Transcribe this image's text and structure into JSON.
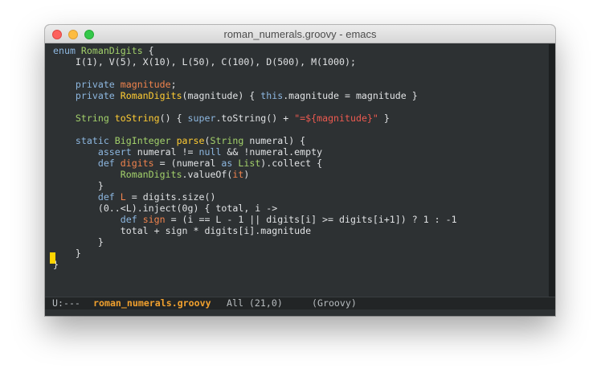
{
  "window": {
    "title": "roman_numerals.groovy - emacs"
  },
  "editor": {
    "lines": [
      [
        {
          "t": "enum ",
          "c": "kw"
        },
        {
          "t": "RomanDigits",
          "c": "ty"
        },
        {
          "t": " {",
          "c": ""
        }
      ],
      [
        {
          "t": "    I(1), V(5), X(10), L(50), C(100), D(500), M(1000);",
          "c": ""
        }
      ],
      [],
      [
        {
          "t": "    ",
          "c": ""
        },
        {
          "t": "private ",
          "c": "kw"
        },
        {
          "t": "magnitude",
          "c": "vr"
        },
        {
          "t": ";",
          "c": ""
        }
      ],
      [
        {
          "t": "    ",
          "c": ""
        },
        {
          "t": "private ",
          "c": "kw"
        },
        {
          "t": "RomanDigits",
          "c": "fn"
        },
        {
          "t": "(magnitude) { ",
          "c": ""
        },
        {
          "t": "this",
          "c": "kw"
        },
        {
          "t": ".magnitude = magnitude }",
          "c": ""
        }
      ],
      [],
      [
        {
          "t": "    ",
          "c": ""
        },
        {
          "t": "String ",
          "c": "ty"
        },
        {
          "t": "toString",
          "c": "fn"
        },
        {
          "t": "() { ",
          "c": ""
        },
        {
          "t": "super",
          "c": "kw"
        },
        {
          "t": ".toString() + ",
          "c": ""
        },
        {
          "t": "\"=${magnitude}\"",
          "c": "st"
        },
        {
          "t": " }",
          "c": ""
        }
      ],
      [],
      [
        {
          "t": "    ",
          "c": ""
        },
        {
          "t": "static ",
          "c": "kw"
        },
        {
          "t": "BigInteger ",
          "c": "ty"
        },
        {
          "t": "parse",
          "c": "fn"
        },
        {
          "t": "(",
          "c": ""
        },
        {
          "t": "String",
          "c": "ty"
        },
        {
          "t": " numeral) {",
          "c": ""
        }
      ],
      [
        {
          "t": "        ",
          "c": ""
        },
        {
          "t": "assert",
          "c": "kw"
        },
        {
          "t": " numeral != ",
          "c": ""
        },
        {
          "t": "null",
          "c": "kw"
        },
        {
          "t": " && !numeral.empty",
          "c": ""
        }
      ],
      [
        {
          "t": "        ",
          "c": ""
        },
        {
          "t": "def ",
          "c": "kw"
        },
        {
          "t": "digits",
          "c": "vr"
        },
        {
          "t": " = (numeral ",
          "c": ""
        },
        {
          "t": "as ",
          "c": "kw"
        },
        {
          "t": "List",
          "c": "ty"
        },
        {
          "t": ").collect {",
          "c": ""
        }
      ],
      [
        {
          "t": "            ",
          "c": ""
        },
        {
          "t": "RomanDigits",
          "c": "ty"
        },
        {
          "t": ".valueOf(",
          "c": ""
        },
        {
          "t": "it",
          "c": "vr"
        },
        {
          "t": ")",
          "c": ""
        }
      ],
      [
        {
          "t": "        }",
          "c": ""
        }
      ],
      [
        {
          "t": "        ",
          "c": ""
        },
        {
          "t": "def ",
          "c": "kw"
        },
        {
          "t": "L",
          "c": "vr"
        },
        {
          "t": " = digits.size()",
          "c": ""
        }
      ],
      [
        {
          "t": "        (0..<L).inject(0g) { total, i ->",
          "c": ""
        }
      ],
      [
        {
          "t": "            ",
          "c": ""
        },
        {
          "t": "def ",
          "c": "kw"
        },
        {
          "t": "sign",
          "c": "vr"
        },
        {
          "t": " = (i == L - 1 || digits[i] >= digits[i+1]) ? 1 : -1",
          "c": ""
        }
      ],
      [
        {
          "t": "            total + sign * digits[i].magnitude",
          "c": ""
        }
      ],
      [
        {
          "t": "        }",
          "c": ""
        }
      ],
      [
        {
          "t": "    }",
          "c": ""
        }
      ],
      [
        {
          "t": "}",
          "c": ""
        }
      ]
    ]
  },
  "modeline": {
    "status": "U:---",
    "buffer_name": "roman_numerals.groovy",
    "position": "All (21,0)",
    "major_mode": "(Groovy)"
  },
  "colors": {
    "background": "#2d3133",
    "keyword": "#8db7e0",
    "type": "#a3d16b",
    "function": "#ffcc33",
    "variable": "#f0834d",
    "string": "#ee5a50",
    "cursor": "#ffd400",
    "modeline_buffer": "#f0a02e"
  }
}
